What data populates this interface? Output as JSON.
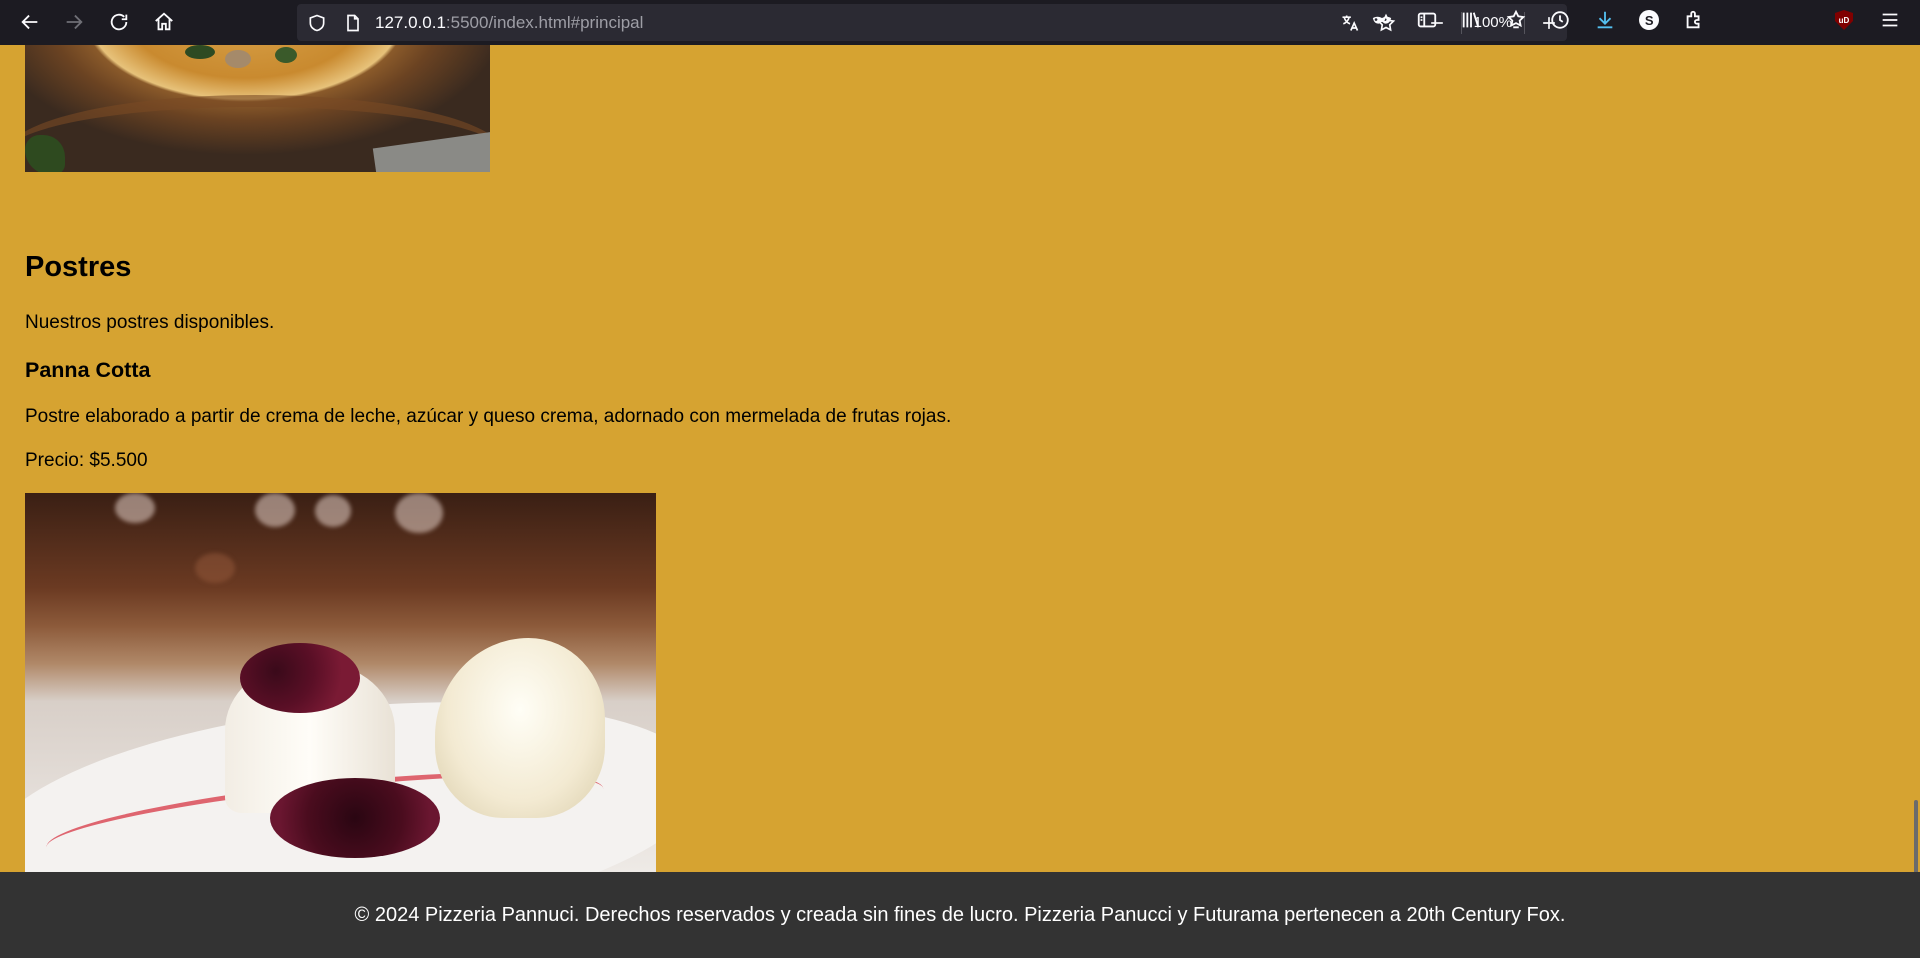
{
  "browser": {
    "url_host": "127.0.0.1",
    "url_rest": ":5500/index.html#principal",
    "zoom": "100%",
    "icons": {
      "back": "arrow-left-icon",
      "forward": "arrow-right-icon",
      "reload": "reload-icon",
      "home": "home-icon",
      "shield": "tracking-shield-icon",
      "page": "page-icon",
      "translate": "translate-icon",
      "bookmark": "star-icon",
      "zoom_out": "minus-icon",
      "zoom_in": "plus-icon",
      "private": "mask-icon",
      "sidebar": "sidebar-icon",
      "library": "library-icon",
      "pocket": "pocket-icon",
      "history": "clock-icon",
      "downloads": "download-icon",
      "account": "s-account-icon",
      "extensions": "extensions-icon",
      "ublock": "ublock-icon",
      "menu": "hamburger-menu-icon"
    },
    "account_letter": "S",
    "ublock_label": "uD"
  },
  "section": {
    "title": "Postres",
    "description": "Nuestros postres disponibles."
  },
  "item": {
    "name": "Panna Cotta",
    "description": "Postre elaborado a partir de crema de leche, azúcar y queso crema, adornado con mermelada de frutas rojas.",
    "price": "Precio: $5.500"
  },
  "footer": {
    "text": "© 2024 Pizzeria Pannuci. Derechos reservados y creada sin fines de lucro. Pizzeria Panucci y Futurama pertenecen a 20th Century Fox."
  },
  "colors": {
    "page_background": "#d6a331",
    "footer_background": "#333333",
    "toolbar_background": "#1c1b22",
    "download_accent": "#54c0f0"
  }
}
